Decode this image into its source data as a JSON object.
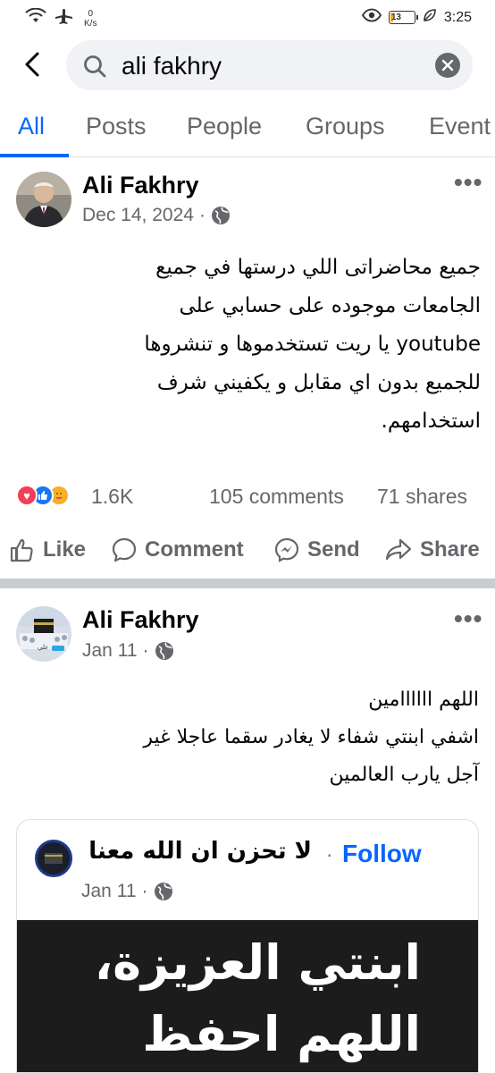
{
  "status_bar": {
    "net_speed_value": "0",
    "net_speed_unit": "K/s",
    "battery": "13",
    "battery_level": 0.13,
    "time": "3:25"
  },
  "search": {
    "query": "ali fakhry"
  },
  "tabs": [
    {
      "label": "All",
      "active": true
    },
    {
      "label": "Posts",
      "active": false
    },
    {
      "label": "People",
      "active": false
    },
    {
      "label": "Groups",
      "active": false
    },
    {
      "label": "Event",
      "active": false
    }
  ],
  "post1": {
    "author": "Ali Fakhry",
    "date": "Dec 14, 2024",
    "separator": "·",
    "text_lines": [
      "جميع محاضراتى اللي درستها في جميع",
      "الجامعات موجوده على حسابي على",
      "youtube يا ريت تستخدموها و تنشروها",
      "للجميع بدون اي مقابل و يكفيني شرف",
      "استخدامهم."
    ],
    "reaction_count": "1.6K",
    "comments": "105 comments",
    "shares": "71 shares"
  },
  "actions": {
    "like": "Like",
    "comment": "Comment",
    "send": "Send",
    "share": "Share"
  },
  "post2": {
    "author": "Ali Fakhry",
    "date": "Jan 11",
    "separator": "·",
    "text_lines": [
      "اللهم اااااامين",
      "اشفي ابنتي شفاء لا يغادر سقما عاجلا غير",
      "آجل يارب العالمين"
    ],
    "shared": {
      "page_name": "لا تحزن ان الله معنا",
      "separator": "·",
      "follow": "Follow",
      "date": "Jan 11",
      "image_lines": [
        "ابنتي العزيزة،",
        "اللهم احفظ"
      ]
    }
  },
  "colors": {
    "accent": "#0866ff",
    "secondary_text": "#65676b",
    "like_blue": "#1877f2",
    "love_red": "#f33e58",
    "care_yellow": "#f7b125"
  }
}
